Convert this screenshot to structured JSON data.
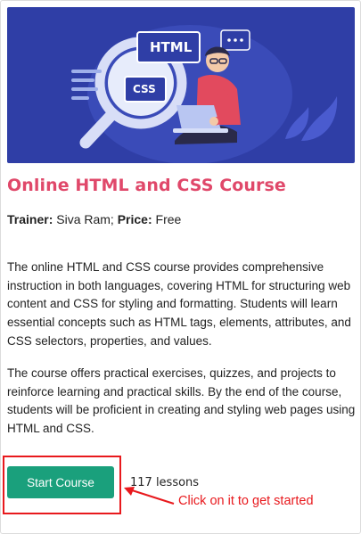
{
  "course": {
    "title": "Online HTML and CSS Course",
    "trainer_label": "Trainer:",
    "trainer_name": "Siva Ram;",
    "price_label": "Price:",
    "price_value": "Free",
    "description": [
      "The online HTML and CSS course provides comprehensive instruction in both languages, covering HTML for structuring web content and CSS for styling and formatting. Students will learn essential concepts such as HTML tags, elements, attributes, and CSS selectors, properties, and values.",
      "The course offers practical exercises, quizzes, and projects to reinforce learning and practical skills. By the end of the course, students will be proficient in creating and styling web pages using HTML and CSS."
    ],
    "start_button_label": "Start Course",
    "lessons_count": "117 lessons"
  },
  "hero": {
    "badge_html": "HTML",
    "badge_css": "CSS"
  },
  "annotation": {
    "callout_text": "Click on it to get started"
  },
  "colors": {
    "hero_bg": "#2f3ea6",
    "title": "#e0486a",
    "button": "#1aa07c",
    "annotation": "#e8191d"
  }
}
